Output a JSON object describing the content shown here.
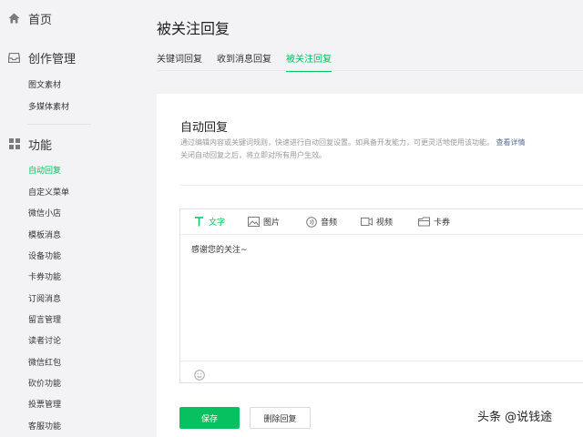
{
  "sidebar": {
    "home": {
      "label": "首页",
      "icon": "home-icon"
    },
    "creation": {
      "label": "创作管理",
      "icon": "inbox-icon",
      "items": [
        "图文素材",
        "多媒体素材"
      ]
    },
    "features": {
      "label": "功能",
      "icon": "grid-icon",
      "items": [
        "自动回复",
        "自定义菜单",
        "微信小店",
        "模板消息",
        "设备功能",
        "卡券功能",
        "订阅消息",
        "留言管理",
        "读者讨论",
        "微信红包",
        "砍价功能",
        "投票管理",
        "客服功能"
      ],
      "active_index": 0
    }
  },
  "main": {
    "title": "被关注回复",
    "tabs": [
      "关键词回复",
      "收到消息回复",
      "被关注回复"
    ],
    "active_tab": 2,
    "panel": {
      "title": "自动回复",
      "desc_line1": "通过编辑内容或关键词规则，快速进行自动回复设置。如具备开发能力，可更灵活地使用该功能。",
      "desc_link": "查看详情",
      "desc_line2": "关闭自动回复之后，将立即对所有用户生效。",
      "toolbar": [
        {
          "label": "文字",
          "icon": "text-icon"
        },
        {
          "label": "图片",
          "icon": "image-icon"
        },
        {
          "label": "音频",
          "icon": "audio-icon"
        },
        {
          "label": "视频",
          "icon": "video-icon"
        },
        {
          "label": "卡券",
          "icon": "card-icon"
        }
      ],
      "active_tool": 0,
      "content": "感谢您的关注~",
      "save_label": "保存",
      "delete_label": "删除回复"
    }
  },
  "watermark": "头条 @说钱途",
  "colors": {
    "accent": "#07c160",
    "link": "#576b95",
    "background": "#f3f3f5"
  }
}
